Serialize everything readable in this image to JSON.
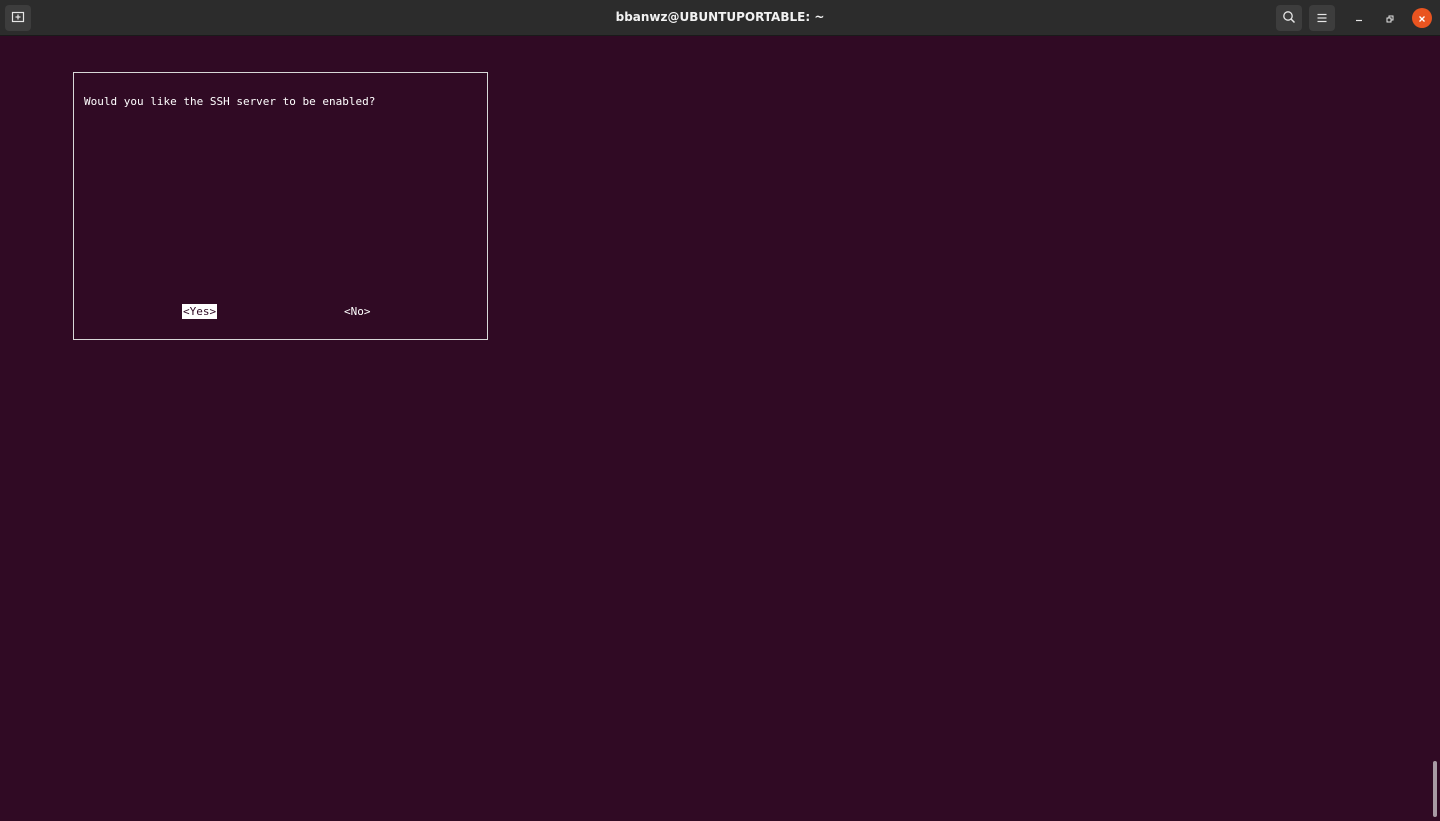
{
  "window": {
    "title": "bbanwz@UBUNTUPORTABLE: ~"
  },
  "titlebar": {
    "icons": {
      "new_tab": "new-tab-icon",
      "search": "search-icon",
      "menu": "hamburger-menu-icon",
      "minimize": "minimize-icon",
      "maximize": "maximize-icon",
      "close": "close-icon"
    }
  },
  "dialog": {
    "question": "Would you like the SSH server to be enabled?",
    "yes_label": "<Yes>",
    "no_label": "<No>",
    "selected": "yes"
  },
  "colors": {
    "terminal_background": "#300a24",
    "titlebar_background": "#2c2c2c",
    "close_button": "#e95420",
    "text": "#ffffff"
  }
}
